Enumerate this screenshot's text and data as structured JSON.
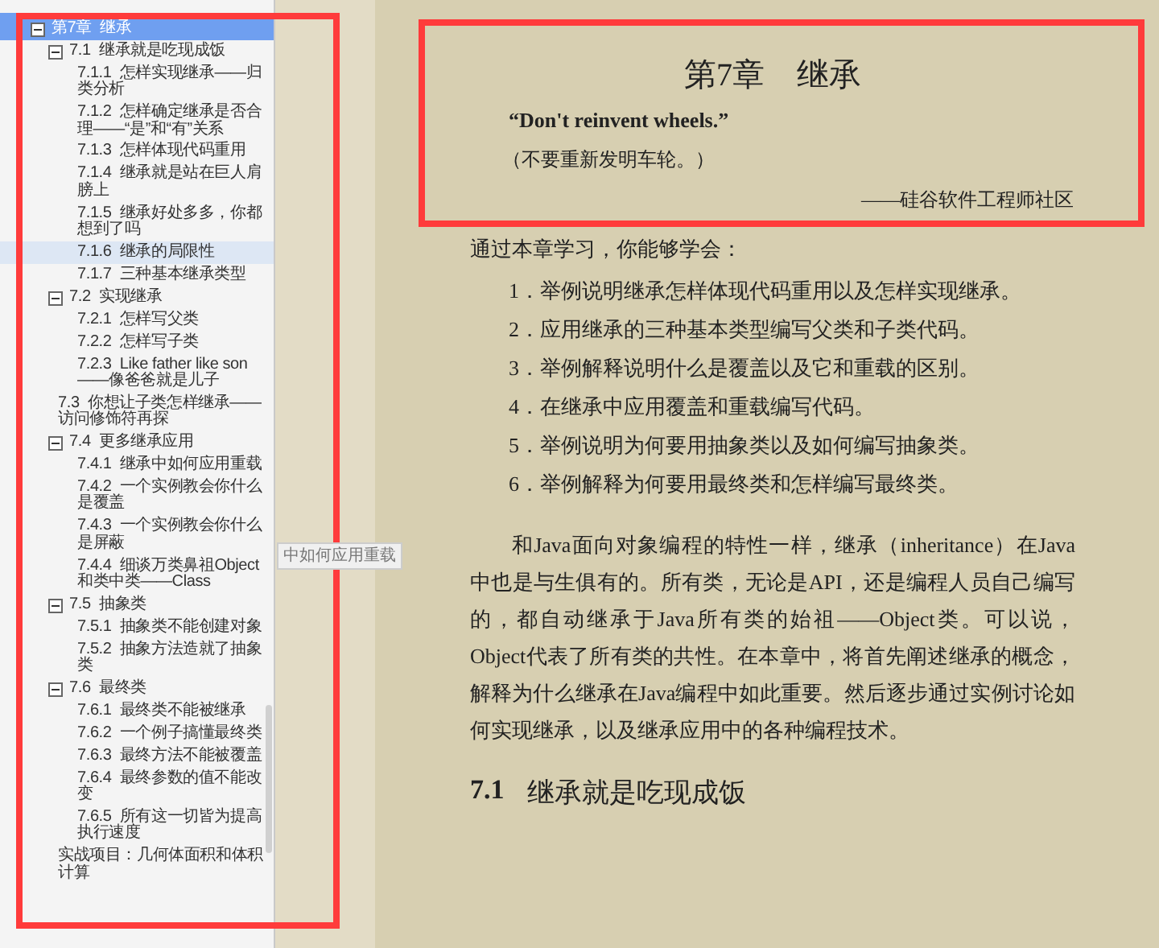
{
  "toc": {
    "items": [
      {
        "label": "第7章  继承",
        "expanded": true,
        "selected": true,
        "children": [
          {
            "label": "7.1  继承就是吃现成饭",
            "expanded": true,
            "selected": false,
            "children": [
              {
                "label": "7.1.1  怎样实现继承——归类分析",
                "selected": false
              },
              {
                "label": "7.1.2  怎样确定继承是否合理——“是”和“有”关系",
                "selected": false
              },
              {
                "label": "7.1.3  怎样体现代码重用",
                "selected": false
              },
              {
                "label": "7.1.4  继承就是站在巨人肩膀上",
                "selected": false
              },
              {
                "label": "7.1.5  继承好处多多，你都想到了吗",
                "selected": false
              },
              {
                "label": "7.1.6  继承的局限性",
                "selected": true
              },
              {
                "label": "7.1.7  三种基本继承类型",
                "selected": false
              }
            ]
          },
          {
            "label": "7.2  实现继承",
            "expanded": true,
            "selected": false,
            "children": [
              {
                "label": "7.2.1  怎样写父类",
                "selected": false
              },
              {
                "label": "7.2.2  怎样写子类",
                "selected": false
              },
              {
                "label": "7.2.3  Like father like son——像爸爸就是儿子",
                "selected": false
              }
            ]
          },
          {
            "label": "7.3  你想让子类怎样继承——访问修饰符再探",
            "selected": false
          },
          {
            "label": "7.4  更多继承应用",
            "expanded": true,
            "selected": false,
            "children": [
              {
                "label": "7.4.1  继承中如何应用重载",
                "selected": false
              },
              {
                "label": "7.4.2  一个实例教会你什么是覆盖",
                "selected": false
              },
              {
                "label": "7.4.3  一个实例教会你什么是屏蔽",
                "selected": false
              },
              {
                "label": "7.4.4  细谈万类鼻祖Object和类中类——Class",
                "selected": false
              }
            ]
          },
          {
            "label": "7.5  抽象类",
            "expanded": true,
            "selected": false,
            "children": [
              {
                "label": "7.5.1  抽象类不能创建对象",
                "selected": false
              },
              {
                "label": "7.5.2  抽象方法造就了抽象类",
                "selected": false
              }
            ]
          },
          {
            "label": "7.6  最终类",
            "expanded": true,
            "selected": false,
            "children": [
              {
                "label": "7.6.1  最终类不能被继承",
                "selected": false
              },
              {
                "label": "7.6.2  一个例子搞懂最终类",
                "selected": false
              },
              {
                "label": "7.6.3  最终方法不能被覆盖",
                "selected": false
              },
              {
                "label": "7.6.4  最终参数的值不能改变",
                "selected": false
              },
              {
                "label": "7.6.5  所有这一切皆为提高执行速度",
                "selected": false
              }
            ]
          },
          {
            "label": "实战项目：几何体面积和体积计算",
            "selected": false
          }
        ]
      }
    ],
    "tooltip": "中如何应用重载"
  },
  "page": {
    "chapter_title": "第7章　继承",
    "epigraph": "“Don't reinvent wheels.”",
    "epigraph_translation": "（不要重新发明车轮。）",
    "attribution": "——硅谷软件工程师社区",
    "intro": "通过本章学习，你能够学会：",
    "objectives": [
      "1．举例说明继承怎样体现代码重用以及怎样实现继承。",
      "2．应用继承的三种基本类型编写父类和子类代码。",
      "3．举例解释说明什么是覆盖以及它和重载的区别。",
      "4．在继承中应用覆盖和重载编写代码。",
      "5．举例说明为何要用抽象类以及如何编写抽象类。",
      "6．举例解释为何要用最终类和怎样编写最终类。"
    ],
    "paragraph": "和Java面向对象编程的特性一样，继承（inheritance）在Java中也是与生俱有的。所有类，无论是API，还是编程人员自己编写的，都自动继承于Java所有类的始祖——Object类。可以说，Object代表了所有类的共性。在本章中，将首先阐述继承的概念，解释为什么继承在Java编程中如此重要。然后逐步通过实例讨论如何实现继承，以及继承应用中的各种编程技术。",
    "section_number": "7.1",
    "section_title": "继承就是吃现成饭"
  },
  "annotations": [
    {
      "kind": "frame",
      "color": "#ff3b3b"
    },
    {
      "kind": "frame",
      "color": "#ff3b3b"
    }
  ]
}
